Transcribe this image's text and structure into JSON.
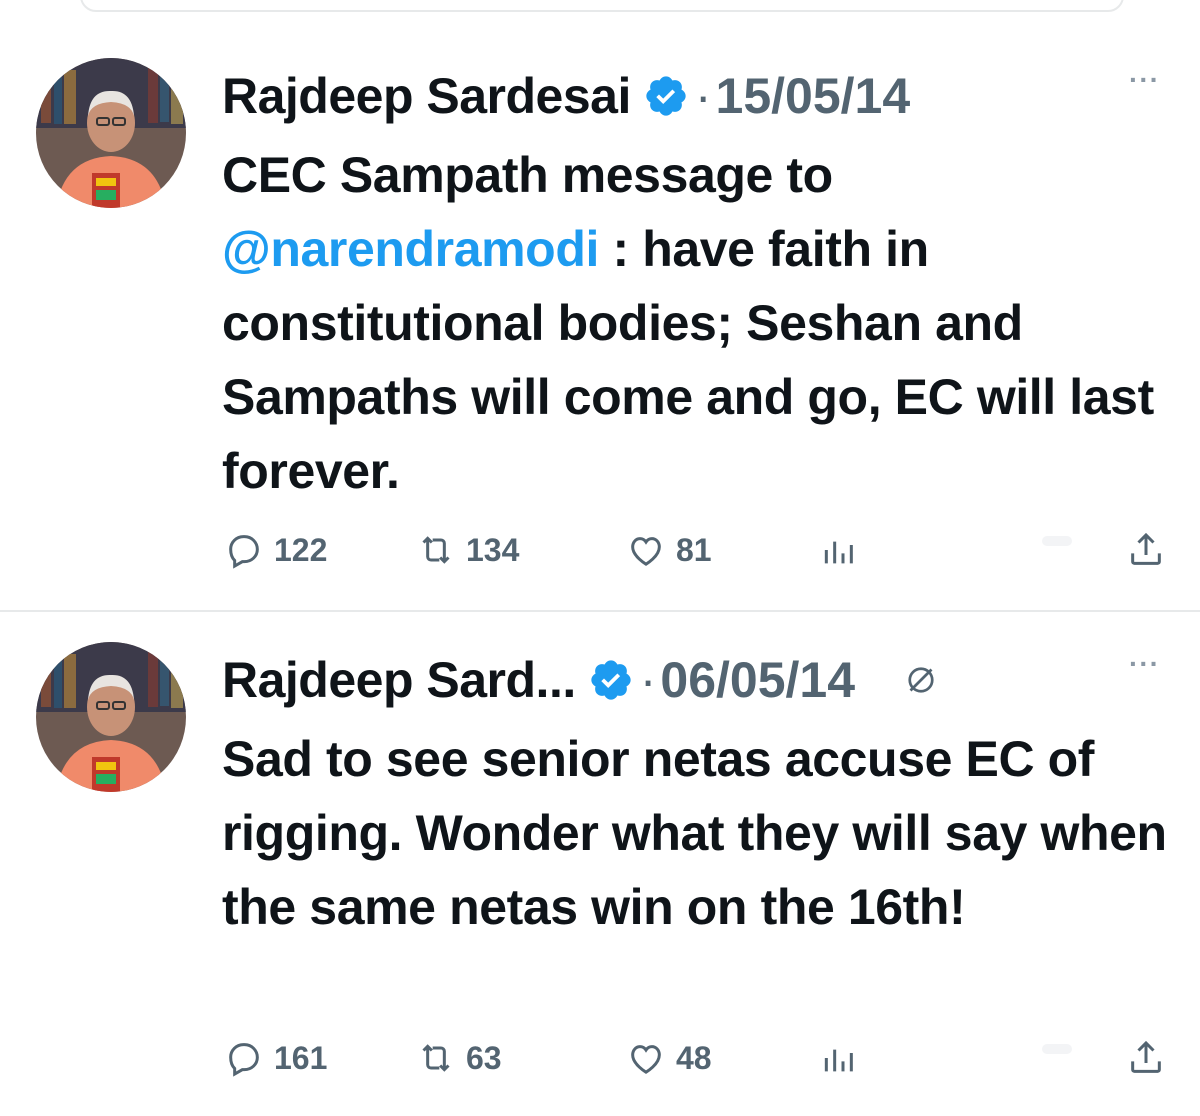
{
  "tweets": [
    {
      "author": "Rajdeep Sardesai",
      "date": "15/05/14",
      "separator": "·",
      "more": "···",
      "text_prefix": "CEC Sampath message to ",
      "mention": "@narendramodi",
      "text_suffix": " : have faith in constitutional bodies; Seshan and Sampaths will come and go, EC will last forever.",
      "replies": "122",
      "reposts": "134",
      "likes": "81"
    },
    {
      "author": "Rajdeep Sard...",
      "date": "06/05/14",
      "separator": "·",
      "more": "···",
      "text": "Sad to see senior netas accuse EC of rigging. Wonder what they will say when the same netas win on the 16th!",
      "replies": "161",
      "reposts": "63",
      "likes": "48"
    }
  ],
  "colors": {
    "accent": "#1d9bf0",
    "muted_text": "#536471",
    "divider": "#e7e9ea"
  },
  "icons": [
    "verified-badge-icon",
    "reply-icon",
    "repost-icon",
    "like-icon",
    "views-icon",
    "share-icon",
    "more-icon",
    "muted-icon",
    "avatar-icon"
  ]
}
